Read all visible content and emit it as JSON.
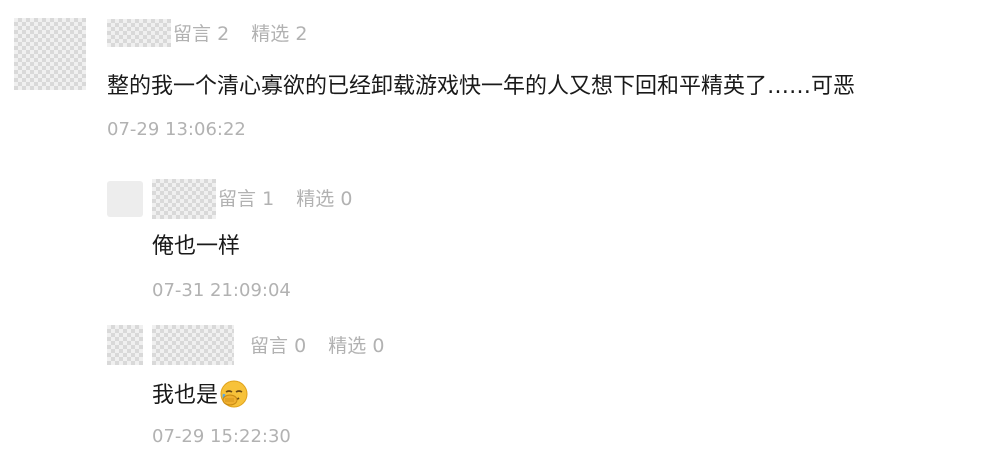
{
  "comments": [
    {
      "stats": {
        "liuyan_label": "留言",
        "liuyan_count": "2",
        "jingxuan_label": "精选",
        "jingxuan_count": "2"
      },
      "content": "整的我一个清心寡欲的已经卸载游戏快一年的人又想下回和平精英了……可恶",
      "time": "07-29 13:06:22"
    },
    {
      "stats": {
        "liuyan_label": "留言",
        "liuyan_count": "1",
        "jingxuan_label": "精选",
        "jingxuan_count": "0"
      },
      "content": "俺也一样",
      "time": "07-31 21:09:04"
    },
    {
      "stats": {
        "liuyan_label": "留言",
        "liuyan_count": "0",
        "jingxuan_label": "精选",
        "jingxuan_count": "0"
      },
      "content": "我也是",
      "emoji": "face-palm-crying-emoji",
      "time": "07-29 15:22:30"
    }
  ],
  "colors": {
    "meta_gray": "#b2b2b2",
    "text": "#1a1a1a",
    "placeholder": "#ededed"
  }
}
